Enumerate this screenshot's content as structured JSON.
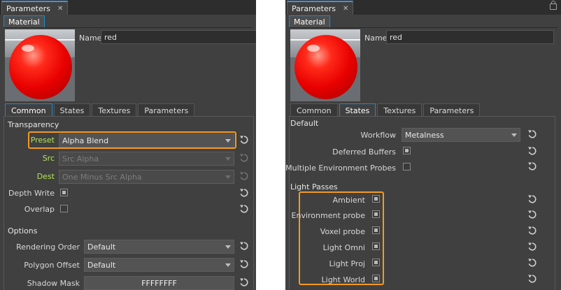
{
  "panels": [
    {
      "title": "Parameters",
      "material_tab": "Material",
      "name_label": "Name",
      "name_value": "red",
      "tabs": [
        "Common",
        "States",
        "Textures",
        "Parameters"
      ],
      "active_tab": "Common",
      "sections": {
        "transparency": "Transparency",
        "options": "Options"
      },
      "rows": {
        "preset": {
          "label": "Preset",
          "value": "Alpha Blend"
        },
        "src": {
          "label": "Src",
          "value": "Src Alpha"
        },
        "dest": {
          "label": "Dest",
          "value": "One Minus Src Alpha"
        },
        "depth_write": {
          "label": "Depth Write",
          "checked": true
        },
        "overlap": {
          "label": "Overlap",
          "checked": false
        },
        "rendering_order": {
          "label": "Rendering Order",
          "value": "Default"
        },
        "polygon_offset": {
          "label": "Polygon Offset",
          "value": "Default"
        },
        "shadow_mask": {
          "label": "Shadow Mask",
          "value": "FFFFFFFF"
        }
      }
    },
    {
      "title": "Parameters",
      "material_tab": "Material",
      "name_label": "Name",
      "name_value": "red",
      "tabs": [
        "Common",
        "States",
        "Textures",
        "Parameters"
      ],
      "active_tab": "States",
      "sections": {
        "default": "Default",
        "light_passes": "Light Passes"
      },
      "rows": {
        "workflow": {
          "label": "Workflow",
          "value": "Metalness"
        },
        "deferred_buffers": {
          "label": "Deferred Buffers",
          "checked": true
        },
        "multiple_env_probes": {
          "label": "Multiple Environment Probes",
          "checked": false
        },
        "ambient": {
          "label": "Ambient",
          "checked": true
        },
        "environment_probe": {
          "label": "Environment probe",
          "checked": true
        },
        "voxel_probe": {
          "label": "Voxel probe",
          "checked": true
        },
        "light_omni": {
          "label": "Light Omni",
          "checked": true
        },
        "light_proj": {
          "label": "Light Proj",
          "checked": true
        },
        "light_world": {
          "label": "Light World",
          "checked": true
        }
      }
    }
  ],
  "icons": {
    "close": "close-icon",
    "lock": "lock-icon",
    "reset": "reset-icon",
    "dropdown": "chevron-down-icon"
  },
  "colors": {
    "panel_bg": "#404040",
    "active_tab_border": "#1e8ac8",
    "highlight": "#f39a1e",
    "green_label": "#b5e25a",
    "sphere": "#ff1a0a"
  }
}
